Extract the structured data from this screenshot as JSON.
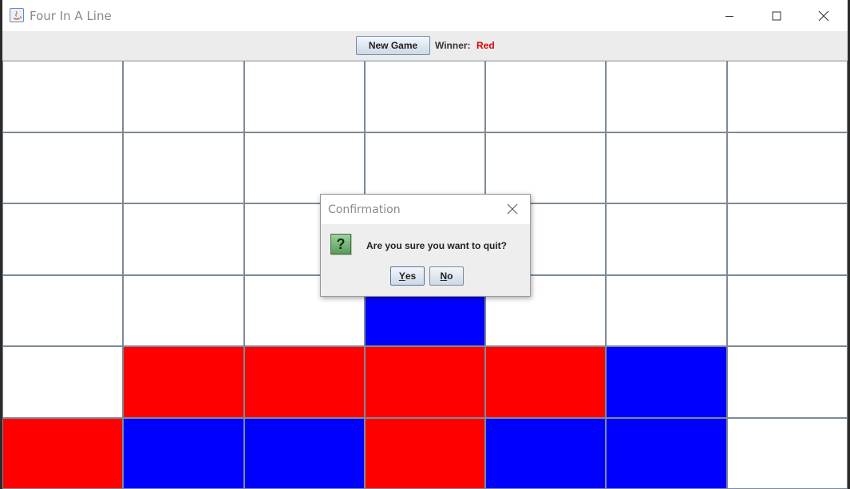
{
  "window": {
    "title": "Four In A Line"
  },
  "toolbar": {
    "new_game_label": "New Game",
    "winner_label": "Winner:",
    "winner_value": "Red"
  },
  "board": {
    "columns": 7,
    "rows": 6,
    "colors": {
      "empty": "#ffffff",
      "red": "#ff0000",
      "blue": "#0000ff",
      "grid": "#7d8a96"
    },
    "cells": [
      [
        "empty",
        "empty",
        "empty",
        "empty",
        "empty",
        "empty",
        "empty"
      ],
      [
        "empty",
        "empty",
        "empty",
        "empty",
        "empty",
        "empty",
        "empty"
      ],
      [
        "empty",
        "empty",
        "empty",
        "empty",
        "empty",
        "empty",
        "empty"
      ],
      [
        "empty",
        "empty",
        "empty",
        "blue",
        "empty",
        "empty",
        "empty"
      ],
      [
        "empty",
        "red",
        "red",
        "red",
        "red",
        "blue",
        "empty"
      ],
      [
        "red",
        "blue",
        "blue",
        "red",
        "blue",
        "blue",
        "empty"
      ]
    ]
  },
  "dialog": {
    "title": "Confirmation",
    "icon": "question-icon",
    "message": "Are you sure you want to quit?",
    "yes_mnemonic": "Y",
    "yes_rest": "es",
    "no_mnemonic": "N",
    "no_rest": "o"
  }
}
